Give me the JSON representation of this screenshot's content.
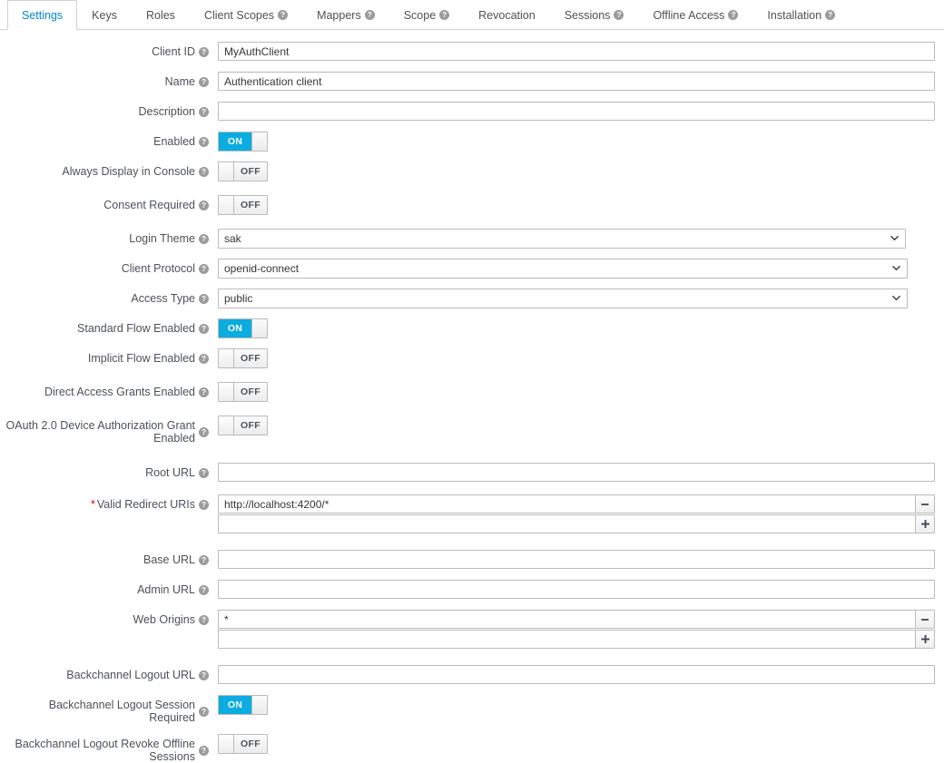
{
  "tabs": [
    {
      "label": "Settings",
      "help": false,
      "active": true
    },
    {
      "label": "Keys",
      "help": false,
      "active": false
    },
    {
      "label": "Roles",
      "help": false,
      "active": false
    },
    {
      "label": "Client Scopes",
      "help": true,
      "active": false
    },
    {
      "label": "Mappers",
      "help": true,
      "active": false
    },
    {
      "label": "Scope",
      "help": true,
      "active": false
    },
    {
      "label": "Revocation",
      "help": false,
      "active": false
    },
    {
      "label": "Sessions",
      "help": true,
      "active": false
    },
    {
      "label": "Offline Access",
      "help": true,
      "active": false
    },
    {
      "label": "Installation",
      "help": true,
      "active": false
    }
  ],
  "icons": {
    "help": "help-circle-icon",
    "chevron": "chevron-down-icon",
    "minus": "minus-icon",
    "plus": "plus-icon"
  },
  "colors": {
    "accent": "#0088ce",
    "toggle_on": "#0bace0",
    "required": "#cc0000",
    "label_text": "#4d5258",
    "border": "#bbbbbb"
  },
  "toggle_labels": {
    "on": "ON",
    "off": "OFF"
  },
  "fields": {
    "client_id": {
      "label": "Client ID",
      "value": "MyAuthClient",
      "placeholder": ""
    },
    "name": {
      "label": "Name",
      "value": "Authentication client",
      "placeholder": ""
    },
    "description": {
      "label": "Description",
      "value": "",
      "placeholder": ""
    },
    "enabled": {
      "label": "Enabled",
      "state": "ON"
    },
    "always_display": {
      "label": "Always Display in Console",
      "state": "OFF"
    },
    "consent_required": {
      "label": "Consent Required",
      "state": "OFF"
    },
    "login_theme": {
      "label": "Login Theme",
      "value": "sak"
    },
    "client_protocol": {
      "label": "Client Protocol",
      "value": "openid-connect"
    },
    "access_type": {
      "label": "Access Type",
      "value": "public"
    },
    "standard_flow": {
      "label": "Standard Flow Enabled",
      "state": "ON"
    },
    "implicit_flow": {
      "label": "Implicit Flow Enabled",
      "state": "OFF"
    },
    "direct_access": {
      "label": "Direct Access Grants Enabled",
      "state": "OFF"
    },
    "device_grant": {
      "label": "OAuth 2.0 Device Authorization Grant Enabled",
      "state": "OFF"
    },
    "root_url": {
      "label": "Root URL",
      "value": "",
      "placeholder": ""
    },
    "valid_redirect": {
      "label": "Valid Redirect URIs",
      "required": true,
      "values": [
        "http://localhost:4200/*",
        ""
      ]
    },
    "base_url": {
      "label": "Base URL",
      "value": "",
      "placeholder": ""
    },
    "admin_url": {
      "label": "Admin URL",
      "value": "",
      "placeholder": ""
    },
    "web_origins": {
      "label": "Web Origins",
      "values": [
        "*",
        ""
      ]
    },
    "backchannel_url": {
      "label": "Backchannel Logout URL",
      "value": "",
      "placeholder": ""
    },
    "backchannel_session": {
      "label": "Backchannel Logout Session Required",
      "state": "ON"
    },
    "backchannel_revoke": {
      "label": "Backchannel Logout Revoke Offline Sessions",
      "state": "OFF"
    }
  }
}
